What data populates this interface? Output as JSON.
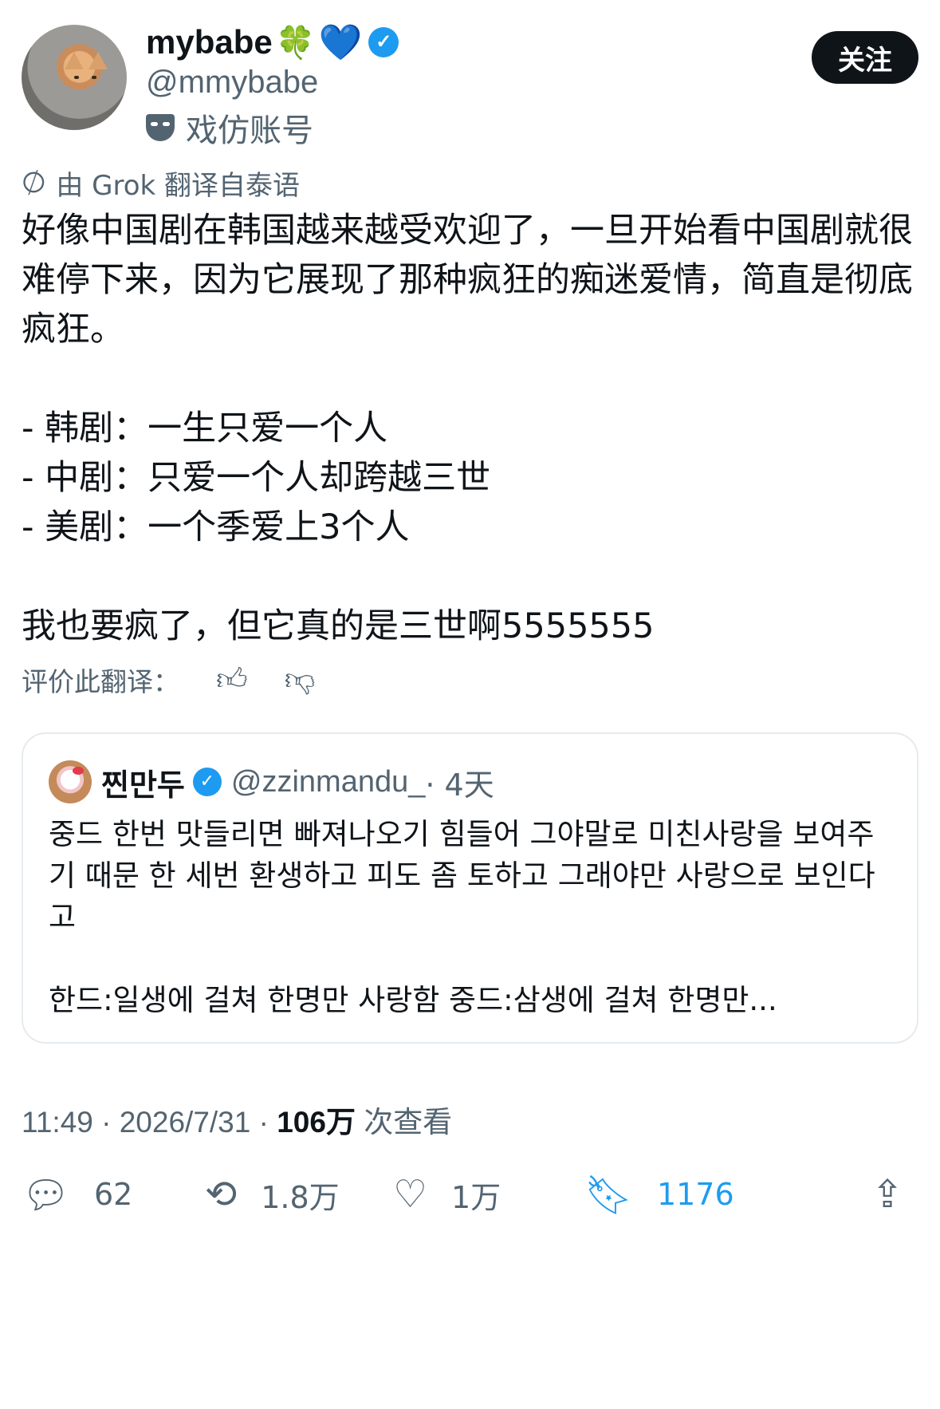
{
  "author": {
    "name": "mybabe",
    "emoji": [
      "🍀",
      "💙"
    ],
    "handle": "@mmybabe",
    "parody_label": "戏仿账号",
    "follow_label": "关注"
  },
  "translation": {
    "notice": "由 Grok 翻译自泰语",
    "rate_label": "评价此翻译："
  },
  "tweet": {
    "lines": [
      "好像中国剧在韩国越来越受欢迎了，一旦开始看中国剧就很难停下来，因为它展现了那种疯狂的痴迷爱情，简直是彻底疯狂。",
      "",
      "- 韩剧：一生只爱一个人",
      "- 中剧：只爱一个人却跨越三世",
      "- 美剧：一个季爱上3个人",
      "",
      "我也要疯了，但它真的是三世啊5555555"
    ]
  },
  "quote": {
    "name": "찐만두",
    "handle": "@zzinmandu_",
    "time": "· 4天",
    "body": [
      "중드 한번 맛들리면 빠져나오기 힘들어 그야말로 미친사랑을 보여주기 때문 한 세번 환생하고 피도 좀 토하고 그래야만 사랑으로 보인다고",
      "",
      "한드:일생에 걸쳐 한명만 사랑함 중드:삼생에 걸쳐 한명만..."
    ]
  },
  "meta": {
    "time": "11:49 · 2026/7/31 · ",
    "views": "106万",
    "views_label": " 次查看"
  },
  "actions": {
    "replies": "62",
    "reposts": "1.8万",
    "likes": "1万",
    "bookmarks": "1176"
  },
  "colors": {
    "accent": "#1d9bf0",
    "text": "#0f1419",
    "muted": "#536471"
  }
}
